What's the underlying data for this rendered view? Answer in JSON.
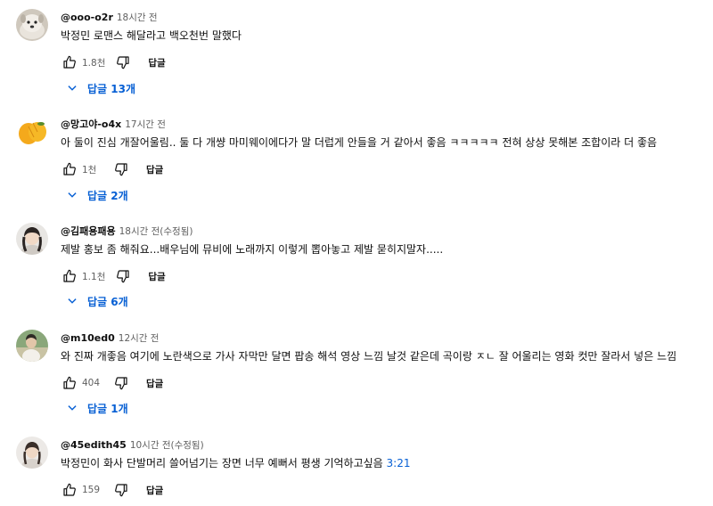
{
  "comments": [
    {
      "author": "@ooo-o2r",
      "time": "18시간 전",
      "text": "박정민 로맨스 해달라고 백오천번 말했다",
      "likes": "1.8천",
      "reply_label": "답글",
      "replies_label": "답글 13개",
      "avatar_icon": "dog-avatar-icon"
    },
    {
      "author": "@망고야-o4x",
      "time": "17시간 전",
      "text": "아 둘이 진심 개잘어울림.. 둘 다 개썅 마미웨이에다가 말 더럽게 안들을 거 같아서 좋음 ㅋㅋㅋㅋㅋ 전혀 상상 못해본 조합이라 더 좋음",
      "likes": "1천",
      "reply_label": "답글",
      "replies_label": "답글 2개",
      "avatar_icon": "mango-avatar-icon"
    },
    {
      "author": "@김패용패용",
      "time": "18시간 전(수정됨)",
      "text": "제발 홍보 좀 해줘요...배우님에 뮤비에 노래까지  이렇게 뽑아놓고 제발 묻히지말자.....",
      "likes": "1.1천",
      "reply_label": "답글",
      "replies_label": "답글 6개",
      "avatar_icon": "person-avatar-icon"
    },
    {
      "author": "@m10ed0",
      "time": "12시간 전",
      "text": "와 진짜 개좋음 여기에 노란색으로 가사 자막만 달면 팝송 해석 영상 느낌 날것 같은데 곡이랑 ㅈㄴ 잘 어울리는 영화 컷만 잘라서 넣은 느낌",
      "likes": "404",
      "reply_label": "답글",
      "replies_label": "답글 1개",
      "avatar_icon": "photo-avatar-icon"
    },
    {
      "author": "@45edith45",
      "time": "10시간 전(수정됨)",
      "text": "박정민이 화사 단발머리 쓸어넘기는 장면 너무 예뻐서 평생 기억하고싶음 ",
      "timestamp_link": "3:21",
      "likes": "159",
      "reply_label": "답글",
      "avatar_icon": "person-avatar-icon"
    }
  ],
  "colors": {
    "link": "#065fd4",
    "secondary_text": "#606060",
    "primary_text": "#0f0f0f"
  }
}
